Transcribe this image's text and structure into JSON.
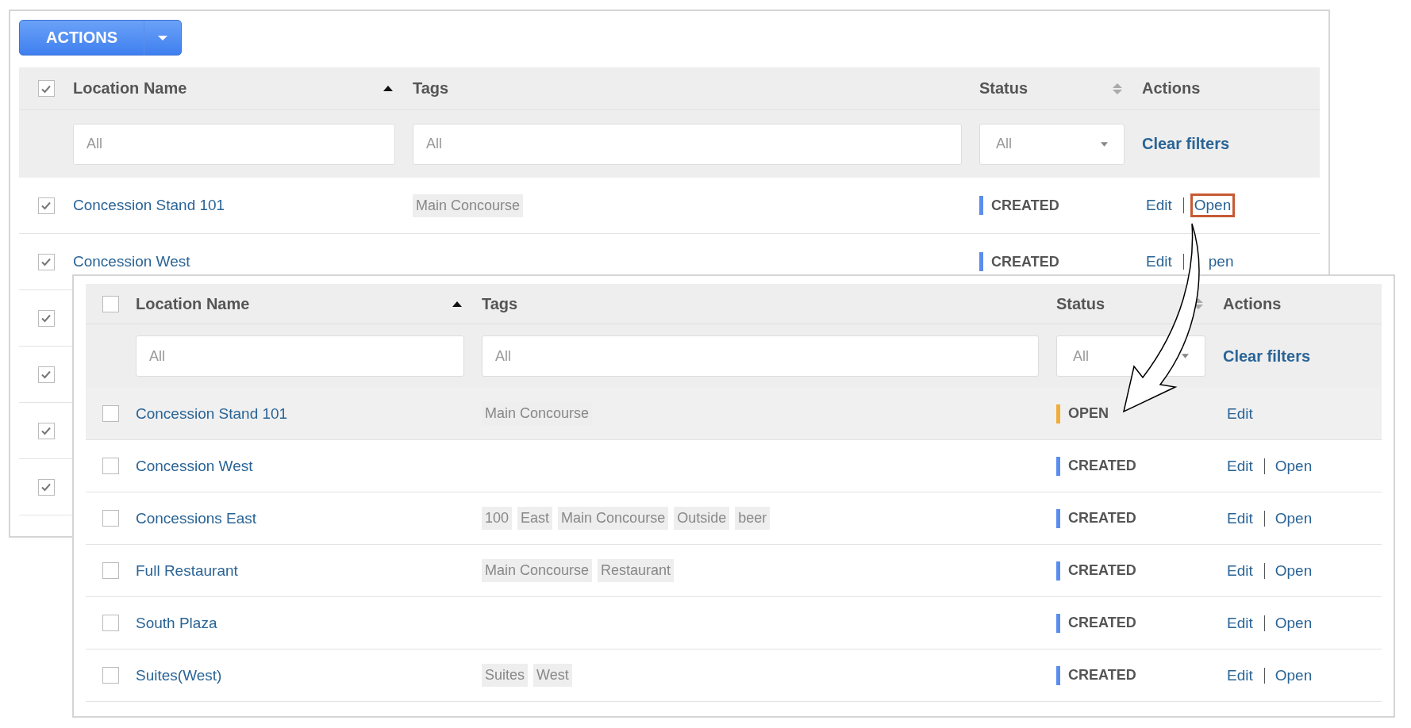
{
  "actions_button": {
    "label": "ACTIONS"
  },
  "back_table": {
    "header_checked": true,
    "columns": [
      {
        "label": "Location Name",
        "sortable": true,
        "ascending": true
      },
      {
        "label": "Tags",
        "sortable": false
      },
      {
        "label": "Status",
        "sortable": true,
        "ascending": false
      },
      {
        "label": "Actions",
        "sortable": false
      }
    ],
    "filters": {
      "location_placeholder": "All",
      "tags_placeholder": "All",
      "status_value": "All",
      "clear_label": "Clear filters"
    },
    "rows": [
      {
        "checked": true,
        "name": "Concession Stand 101",
        "tags": [
          "Main Concourse"
        ],
        "status": {
          "label": "CREATED",
          "color": "#5b8def"
        },
        "actions": [
          {
            "label": "Edit",
            "highlighted": false
          },
          {
            "label": "Open",
            "highlighted": true
          }
        ]
      },
      {
        "checked": true,
        "name": "Concession West",
        "tags": [],
        "status": {
          "label": "CREATED",
          "color": "#5b8def"
        },
        "actions": [
          {
            "label": "Edit",
            "highlighted": false
          },
          {
            "label": "pen",
            "highlighted": false
          }
        ]
      },
      {
        "checked": true
      },
      {
        "checked": true
      },
      {
        "checked": true
      },
      {
        "checked": true
      }
    ]
  },
  "front_table": {
    "header_checked": false,
    "columns": [
      {
        "label": "Location Name",
        "sortable": true,
        "ascending": true
      },
      {
        "label": "Tags",
        "sortable": false
      },
      {
        "label": "Status",
        "sortable": true,
        "ascending": false
      },
      {
        "label": "Actions",
        "sortable": false
      }
    ],
    "filters": {
      "location_placeholder": "All",
      "tags_placeholder": "All",
      "status_value": "All",
      "clear_label": "Clear filters"
    },
    "rows": [
      {
        "checked": false,
        "selected": true,
        "name": "Concession Stand 101",
        "tags": [
          "Main Concourse"
        ],
        "status": {
          "label": "OPEN",
          "color": "#f0ad3c"
        },
        "actions": [
          {
            "label": "Edit",
            "highlighted": false
          }
        ]
      },
      {
        "checked": false,
        "selected": false,
        "name": "Concession West",
        "tags": [],
        "status": {
          "label": "CREATED",
          "color": "#5b8def"
        },
        "actions": [
          {
            "label": "Edit",
            "highlighted": false
          },
          {
            "label": "Open",
            "highlighted": false
          }
        ]
      },
      {
        "checked": false,
        "selected": false,
        "name": "Concessions East",
        "tags": [
          "100",
          "East",
          "Main Concourse",
          "Outside",
          "beer"
        ],
        "status": {
          "label": "CREATED",
          "color": "#5b8def"
        },
        "actions": [
          {
            "label": "Edit",
            "highlighted": false
          },
          {
            "label": "Open",
            "highlighted": false
          }
        ]
      },
      {
        "checked": false,
        "selected": false,
        "name": "Full Restaurant",
        "tags": [
          "Main Concourse",
          "Restaurant"
        ],
        "status": {
          "label": "CREATED",
          "color": "#5b8def"
        },
        "actions": [
          {
            "label": "Edit",
            "highlighted": false
          },
          {
            "label": "Open",
            "highlighted": false
          }
        ]
      },
      {
        "checked": false,
        "selected": false,
        "name": "South Plaza",
        "tags": [],
        "status": {
          "label": "CREATED",
          "color": "#5b8def"
        },
        "actions": [
          {
            "label": "Edit",
            "highlighted": false
          },
          {
            "label": "Open",
            "highlighted": false
          }
        ]
      },
      {
        "checked": false,
        "selected": false,
        "name": "Suites(West)",
        "tags": [
          "Suites",
          "West"
        ],
        "status": {
          "label": "CREATED",
          "color": "#5b8def"
        },
        "actions": [
          {
            "label": "Edit",
            "highlighted": false
          },
          {
            "label": "Open",
            "highlighted": false
          }
        ]
      }
    ]
  }
}
